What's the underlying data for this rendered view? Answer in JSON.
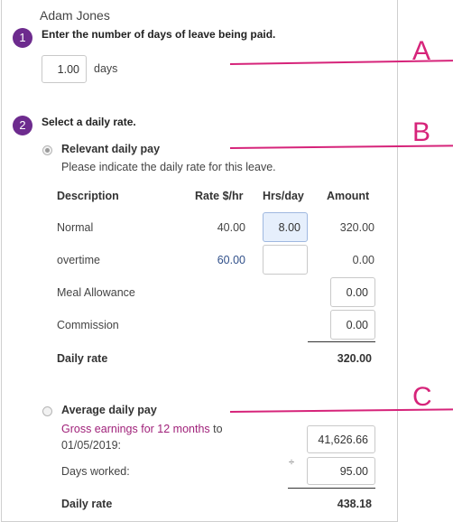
{
  "employee_name": "Adam Jones",
  "step1": {
    "number": "1",
    "title": "Enter the number of days of leave being paid.",
    "days_value": "1.00",
    "days_unit": "days"
  },
  "step2": {
    "number": "2",
    "title": "Select a daily rate."
  },
  "relevant": {
    "label": "Relevant daily pay",
    "note": "Please indicate the daily rate for this leave.",
    "selected": true,
    "columns": {
      "description": "Description",
      "rate": "Rate $/hr",
      "hrs": "Hrs/day",
      "amount": "Amount"
    },
    "rows": [
      {
        "description": "Normal",
        "rate": "40.00",
        "hrs": "8.00",
        "amount": "320.00"
      },
      {
        "description": "overtime",
        "rate": "60.00",
        "hrs": "",
        "amount": "0.00"
      },
      {
        "description": "Meal Allowance",
        "rate": "",
        "hrs": "",
        "amount": "0.00"
      },
      {
        "description": "Commission",
        "rate": "",
        "hrs": "",
        "amount": "0.00"
      }
    ],
    "total_label": "Daily rate",
    "total_value": "320.00"
  },
  "average": {
    "label": "Average daily pay",
    "selected": false,
    "gross_link": "Gross earnings for 12 months",
    "gross_to": " to",
    "gross_date": "01/05/2019:",
    "gross_value": "41,626.66",
    "days_label": "Days worked:",
    "divide_symbol": "÷",
    "days_value": "95.00",
    "total_label": "Daily rate",
    "total_value": "438.18"
  },
  "callouts": {
    "a": "A",
    "b": "B",
    "c": "C"
  },
  "colors": {
    "accent": "#d6247a",
    "step_badge": "#6d2b8e",
    "link": "#a0227a",
    "active_field": "#e6effc"
  }
}
